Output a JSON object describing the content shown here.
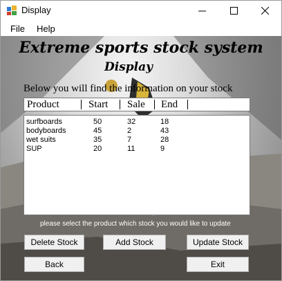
{
  "window": {
    "title": "Display",
    "icon": "windows-form-icon"
  },
  "menu": [
    "File",
    "Help"
  ],
  "heading": {
    "title": "Extreme sports stock system",
    "subtitle": "Display",
    "info": "Below you will find the information  on your stock"
  },
  "table": {
    "columns": [
      "Product",
      "Start",
      "Sale",
      "End"
    ],
    "rows": [
      [
        "surfboards",
        "50",
        "32",
        "18"
      ],
      [
        "bodyboards",
        "45",
        "2",
        "43"
      ],
      [
        "wet suits",
        "35",
        "7",
        "28"
      ],
      [
        "SUP",
        "20",
        "11",
        "9"
      ]
    ]
  },
  "hint": "please select the product which stock you would like to update",
  "buttons": {
    "delete": "Delete Stock",
    "add": "Add Stock",
    "update": "Update Stock",
    "back": "Back",
    "exit": "Exit"
  }
}
